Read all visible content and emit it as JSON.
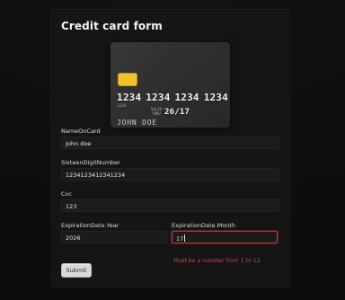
{
  "page": {
    "title": "Credit card form"
  },
  "card_preview": {
    "number_groups": [
      "1234",
      "1234",
      "1234",
      "1234"
    ],
    "small_number": "1234",
    "valid_thru": "VALID\nTHRU",
    "expiry": "26/17",
    "name": "JOHN DOE",
    "chip_color": "#f2c12e"
  },
  "form": {
    "name": {
      "label": "NameOnCard",
      "value": "John doe"
    },
    "number": {
      "label": "SixteenDigitNumber",
      "value": "1234123412341234"
    },
    "cvc": {
      "label": "Cvc",
      "value": "123"
    },
    "exp_year": {
      "label": "ExpirationDate.Year",
      "value": "2026"
    },
    "exp_month": {
      "label": "ExpirationDate.Month",
      "value": "17",
      "error": "Must be a number from 1 to 12"
    },
    "submit_label": "Submit"
  },
  "colors": {
    "background": "#0b0b0b",
    "panel": "#151515",
    "input": "#1b1b1b",
    "error": "#c84b4b",
    "error_border": "#b33a3a",
    "button": "#d9d9d9"
  }
}
